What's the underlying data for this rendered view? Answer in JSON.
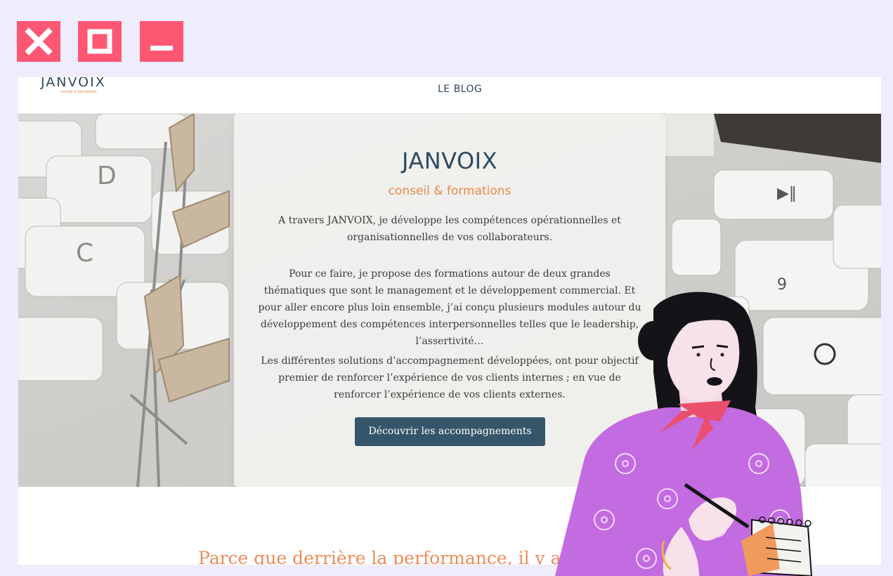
{
  "window_controls": {
    "close_icon": "close-icon",
    "maximize_icon": "maximize-icon",
    "minimize_icon": "minimize-icon",
    "color": "#fe5774"
  },
  "header": {
    "logo_name": "JANVOIX",
    "logo_tagline": "conseil & formations",
    "nav_blog": "LE BLOG"
  },
  "hero": {
    "title": "JANVOIX",
    "subtitle": "conseil & formations",
    "paragraph_1": "A travers JANVOIX, je développe les compétences opérationnelles et organisationnelles de vos collaborateurs.",
    "paragraph_2": "Pour ce faire, je propose des formations autour de deux grandes thématiques que sont le management et le développement commercial. Et pour aller encore plus loin ensemble,  j’ai conçu plusieurs modules autour du développement des compétences interpersonnelles telles que le leadership, l’assertivité…",
    "paragraph_3": "Les différentes solutions d’accompagnement développées, ont pour objectif premier de renforcer l’expérience de vos clients internes ; en vue de renforcer l’expérience de vos clients externes.",
    "cta_label": "Découvrir les accompagnements"
  },
  "section": {
    "tagline": "Parce que derrière la performance, il y a l"
  },
  "colors": {
    "brand_dark": "#35566a",
    "brand_orange": "#ea8a48",
    "page_bg": "#efedfb"
  }
}
